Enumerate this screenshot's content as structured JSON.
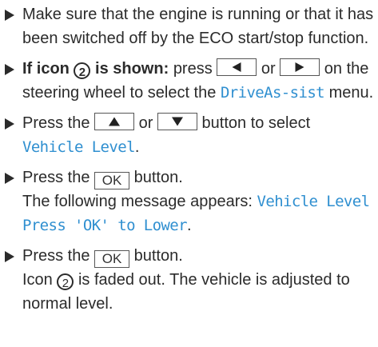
{
  "steps": [
    {
      "text": "Make sure that the engine is running or that it has been switched off by the ECO start/stop function."
    },
    {
      "bold_prefix": "If icon",
      "icon_number": "2",
      "bold_suffix": "is shown:",
      "t1": "press",
      "t2": "or",
      "t3": "on the steering wheel to select the",
      "menu": "DriveAs-sist",
      "t4": "menu."
    },
    {
      "t1": "Press the",
      "t2": "or",
      "t3": "button to select",
      "target": "Vehicle Level",
      "t4": "."
    },
    {
      "t1": "Press the",
      "key": "OK",
      "t2": "button.",
      "t3": "The following message appears:",
      "message": "Vehicle Level Press 'OK' to Lower",
      "t4": "."
    },
    {
      "t1": "Press the",
      "key": "OK",
      "t2": "button.",
      "t3": "Icon",
      "icon_number": "2",
      "t4": "is faded out. The vehicle is adjusted to normal level."
    }
  ]
}
